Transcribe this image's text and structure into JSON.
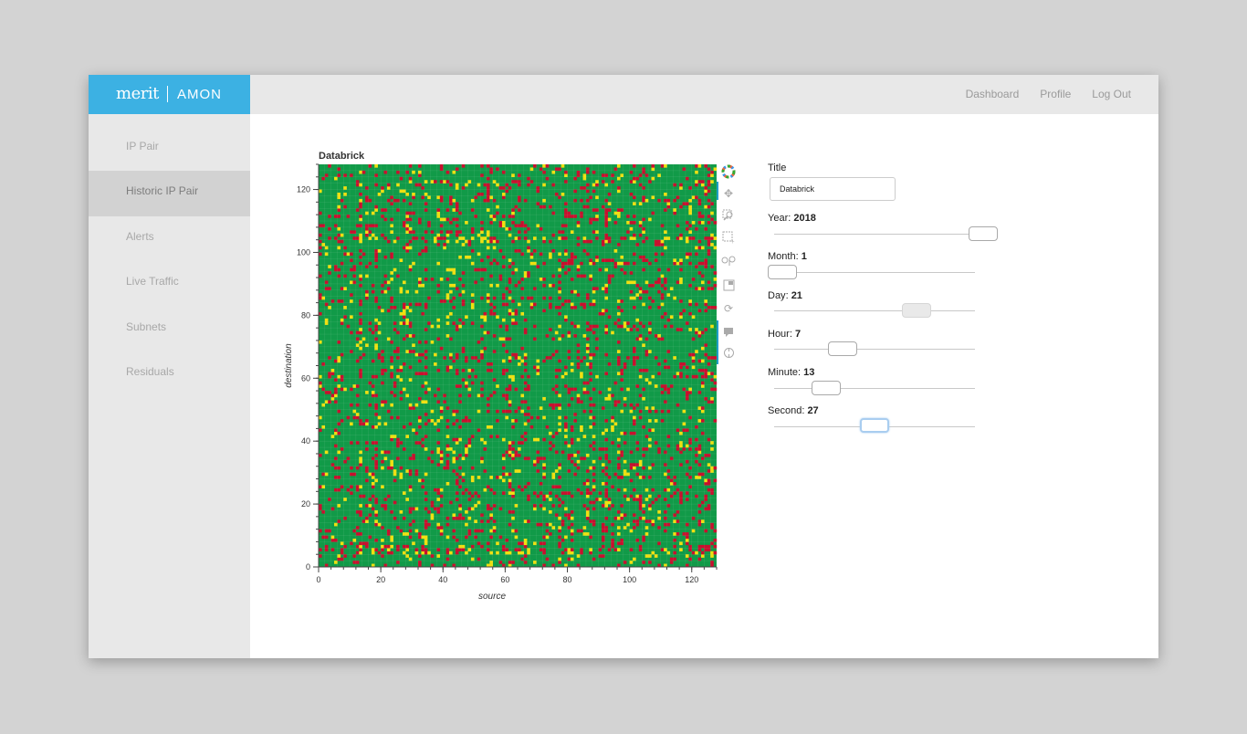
{
  "brand": {
    "logo": "merit",
    "app_name": "AMON"
  },
  "nav": {
    "dashboard": "Dashboard",
    "profile": "Profile",
    "logout": "Log Out"
  },
  "sidebar": {
    "items": [
      {
        "label": "IP Pair",
        "active": false
      },
      {
        "label": "Historic IP Pair",
        "active": true
      },
      {
        "label": "Alerts",
        "active": false
      },
      {
        "label": "Live Traffic",
        "active": false
      },
      {
        "label": "Subnets",
        "active": false
      },
      {
        "label": "Residuals",
        "active": false
      }
    ]
  },
  "toolbar_icons": [
    "logo-icon",
    "pan-icon",
    "box-zoom-icon",
    "box-select-icon",
    "wheel-zoom-icon",
    "save-icon",
    "reset-icon",
    "hover-icon",
    "crosshair-icon"
  ],
  "colors": {
    "brand": "#3cb1e3",
    "green": "#119a48",
    "red": "#c8102e",
    "yellow": "#f0e010",
    "accent": "#1e9ec8"
  },
  "chart_data": {
    "type": "heatmap",
    "title": "Databrick",
    "xlabel": "source",
    "ylabel": "destination",
    "xlim": [
      0,
      128
    ],
    "ylim": [
      0,
      128
    ],
    "xticks": [
      0,
      20,
      40,
      60,
      80,
      100,
      120
    ],
    "yticks": [
      0,
      20,
      40,
      60,
      80,
      100,
      120
    ],
    "grid_size": 128,
    "color_levels": [
      "green",
      "yellow",
      "red"
    ],
    "cell_values": "128x128 grid of cells, mostly green with scattered red and yellow cells"
  },
  "controls": {
    "title_label": "Title",
    "title_value": "Databrick",
    "sliders": [
      {
        "label": "Year",
        "value": "2018",
        "fraction": 1.0
      },
      {
        "label": "Month",
        "value": "1",
        "fraction": 0.0
      },
      {
        "label": "Day",
        "value": "21",
        "fraction": 0.67
      },
      {
        "label": "Hour",
        "value": "7",
        "fraction": 0.3
      },
      {
        "label": "Minute",
        "value": "13",
        "fraction": 0.22
      },
      {
        "label": "Second",
        "value": "27",
        "fraction": 0.46
      }
    ]
  }
}
